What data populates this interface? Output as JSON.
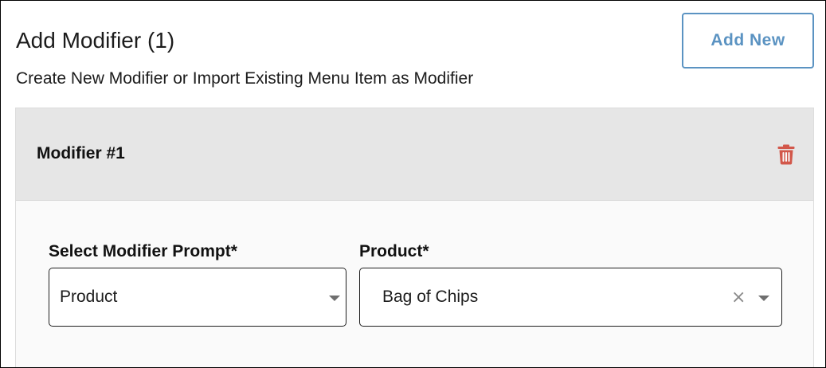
{
  "header": {
    "title": "Add Modifier (1)",
    "subtitle": "Create New Modifier or Import Existing Menu Item as Modifier",
    "add_new_label": "Add New"
  },
  "modifier": {
    "title": "Modifier #1",
    "delete_icon": "trash-icon",
    "prompt_field": {
      "label": "Select Modifier Prompt*",
      "value": "Product"
    },
    "product_field": {
      "label": "Product*",
      "value": "Bag of Chips",
      "clear_glyph": "×"
    }
  },
  "colors": {
    "accent": "#5b93c2",
    "delete": "#d2574a",
    "header_bg": "#e6e6e6",
    "card_bg": "#fafafa"
  }
}
